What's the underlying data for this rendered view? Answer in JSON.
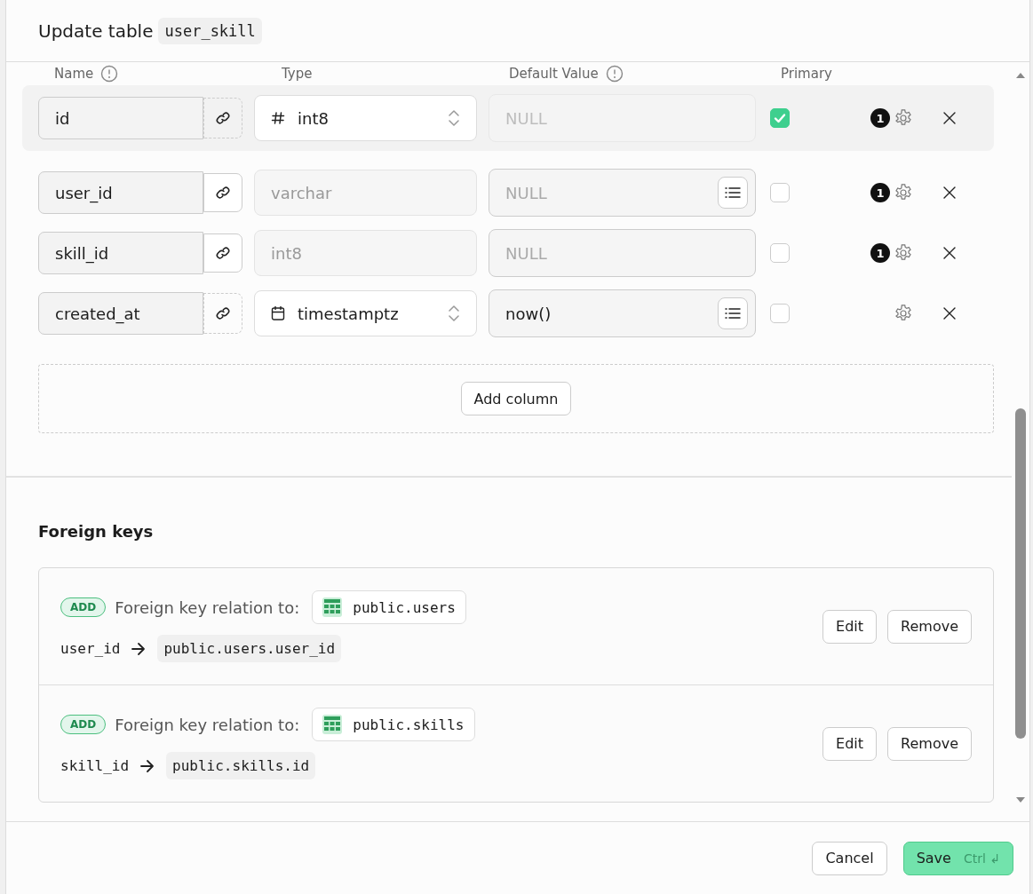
{
  "dialog": {
    "title": "Update table",
    "table_name": "user_skill"
  },
  "column_headers": [
    {
      "label": "Name",
      "help": true
    },
    {
      "label": "Type",
      "help": false
    },
    {
      "label": "Default Value",
      "help": true
    },
    {
      "label": "Primary",
      "help": false
    }
  ],
  "columns": [
    {
      "name": "id",
      "linked": false,
      "highlighted": true,
      "type": {
        "value": "int8",
        "editable": true,
        "kind": "number"
      },
      "default": {
        "placeholder": "NULL",
        "disabled": true,
        "menu": false
      },
      "primary": true,
      "badge": "1"
    },
    {
      "name": "user_id",
      "linked": true,
      "highlighted": false,
      "type": {
        "value": "varchar",
        "editable": false,
        "kind": "text"
      },
      "default": {
        "placeholder": "NULL",
        "disabled": false,
        "menu": true
      },
      "primary": false,
      "badge": "1"
    },
    {
      "name": "skill_id",
      "linked": true,
      "highlighted": false,
      "type": {
        "value": "int8",
        "editable": false,
        "kind": "text"
      },
      "default": {
        "placeholder": "NULL",
        "disabled": false,
        "menu": false
      },
      "primary": false,
      "badge": "1"
    },
    {
      "name": "created_at",
      "linked": false,
      "highlighted": false,
      "type": {
        "value": "timestamptz",
        "editable": true,
        "kind": "date"
      },
      "default": {
        "value": "now()",
        "disabled": false,
        "menu": true
      },
      "primary": false
    }
  ],
  "add_column_button": "Add column",
  "foreign_keys": {
    "title": "Foreign keys",
    "items": [
      {
        "status": "ADD",
        "label": "Foreign key relation to:",
        "table": "public.users",
        "source": "user_id",
        "target": "public.users.user_id",
        "edit": "Edit",
        "remove": "Remove"
      },
      {
        "status": "ADD",
        "label": "Foreign key relation to:",
        "table": "public.skills",
        "source": "skill_id",
        "target": "public.skills.id",
        "edit": "Edit",
        "remove": "Remove"
      }
    ]
  },
  "footer": {
    "cancel": "Cancel",
    "save": "Save",
    "shortcut": "Ctrl ↲"
  }
}
